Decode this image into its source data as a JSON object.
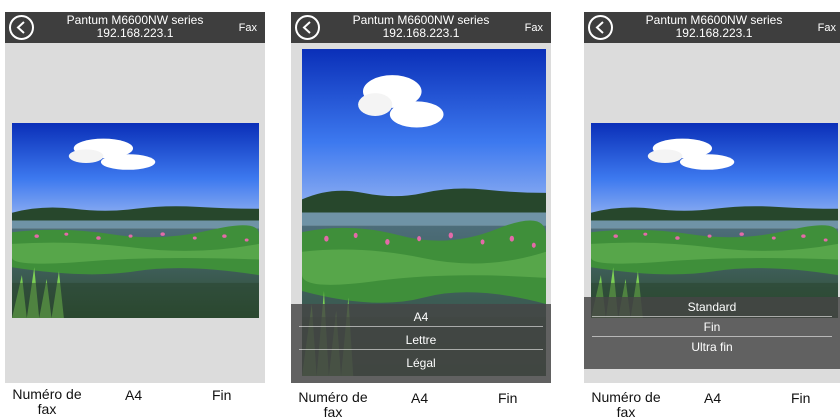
{
  "header": {
    "device_name": "Pantum M6600NW series",
    "ip_address": "192.168.223.1",
    "mode_label": "Fax"
  },
  "icons": {
    "back": "back-arrow-circle-icon"
  },
  "bottom": {
    "fax_number_label": "Numéro de fax",
    "paper_size_value": "A4",
    "resolution_value": "Fin"
  },
  "paper_size_picker": {
    "options": [
      "A4",
      "Lettre",
      "Légal"
    ]
  },
  "resolution_picker": {
    "options": [
      "Standard",
      "Fin",
      "Ultra fin"
    ]
  },
  "colors": {
    "topbar": "#3e3e3e",
    "screen_background": "#dcdcdc",
    "picker_overlay": "#464646"
  }
}
